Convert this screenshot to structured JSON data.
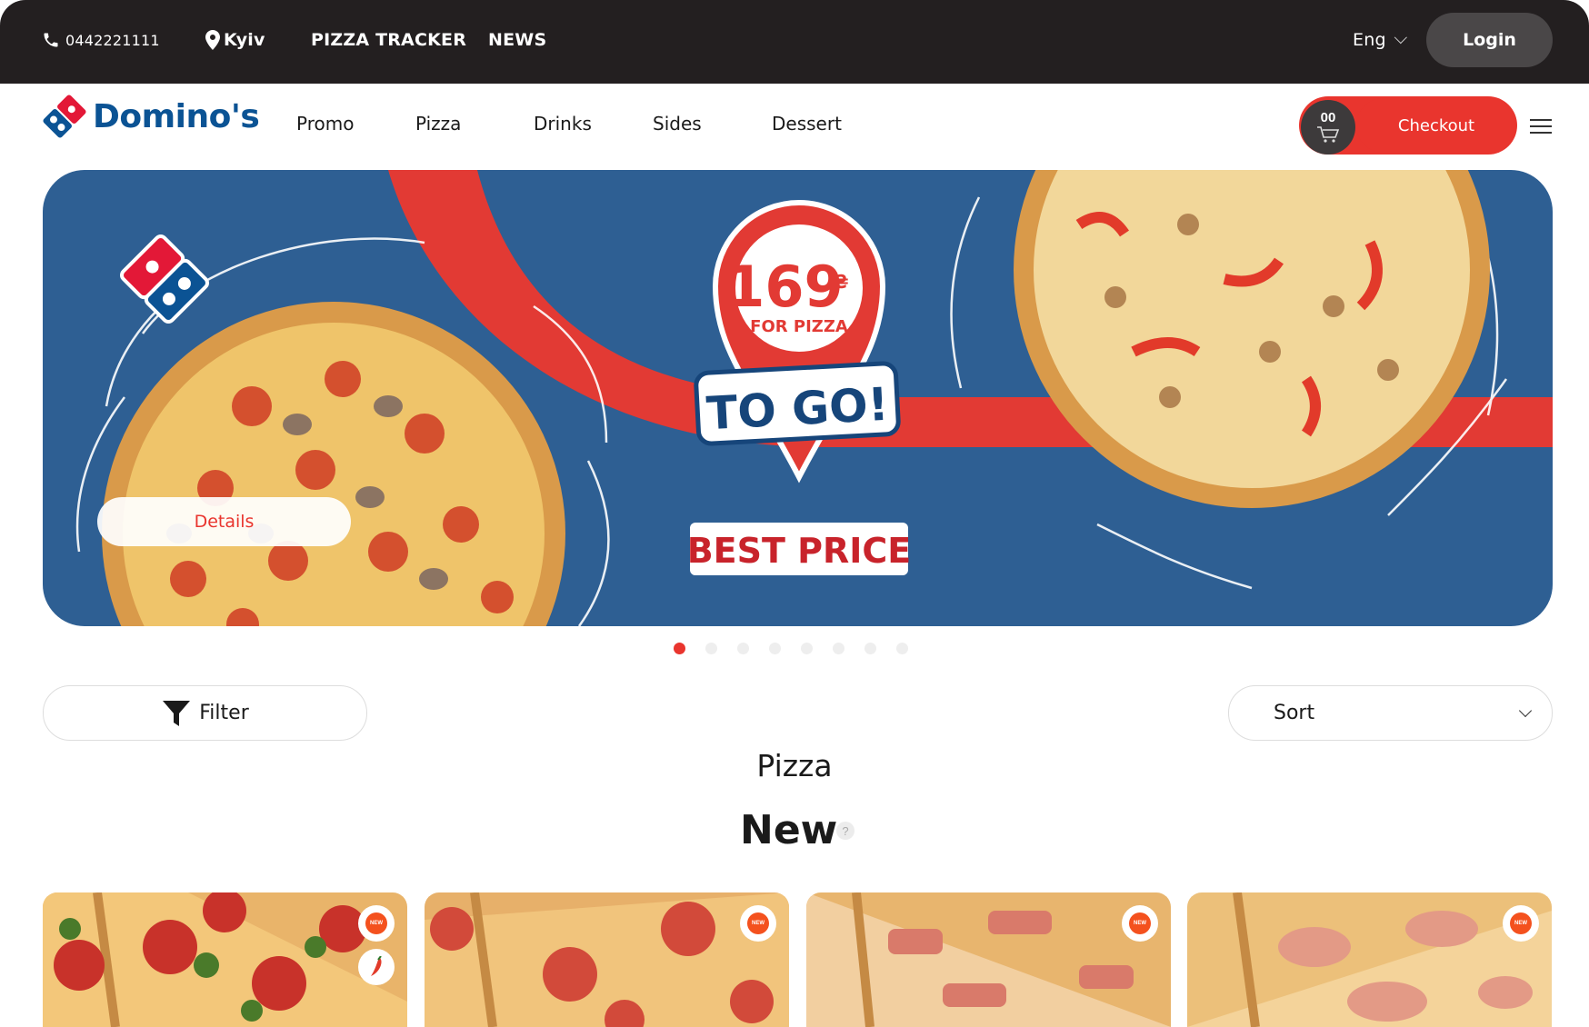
{
  "topbar": {
    "phone": "0442221111",
    "city": "Kyiv",
    "tracker_label": "PIZZA TRACKER",
    "news_label": "NEWS",
    "language": "Eng",
    "login_label": "Login"
  },
  "nav": {
    "logo_text": "Domino's",
    "items": [
      "Promo",
      "Pizza",
      "Drinks",
      "Sides",
      "Dessert"
    ],
    "cart_count": "00",
    "checkout_label": "Checkout"
  },
  "banner": {
    "price": "169",
    "currency": "₴",
    "price_caption": "FOR PIZZA",
    "headline": "TO GO!",
    "tagline": "BEST PRICE",
    "details_label": "Details",
    "slide_count": 8,
    "active_slide": 1
  },
  "controls": {
    "filter_label": "Filter",
    "sort_label": "Sort"
  },
  "catalog": {
    "section_title": "Pizza",
    "group_title": "New",
    "help": "?",
    "badge_text": "NEW"
  },
  "colors": {
    "brand_blue": "#2e5f93",
    "brand_red": "#e9352e",
    "topbar_bg": "#231f20"
  }
}
